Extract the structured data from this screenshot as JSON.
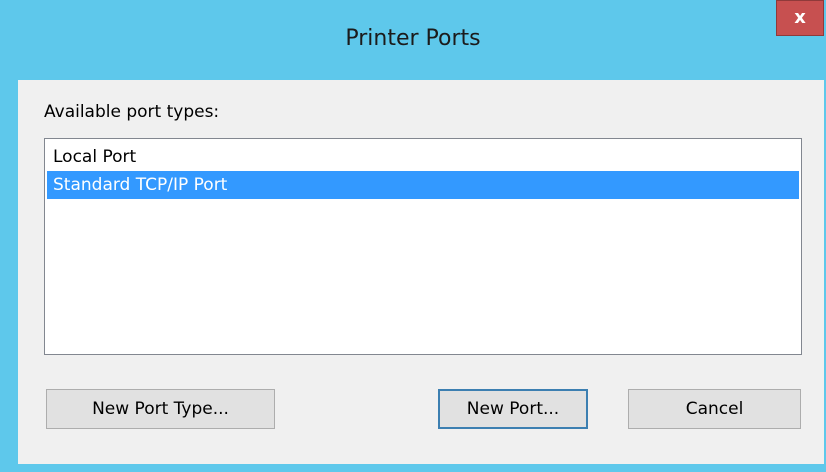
{
  "window": {
    "title": "Printer Ports",
    "close_label": "x"
  },
  "dialog": {
    "label": "Available port types:",
    "items": [
      {
        "label": "Local Port",
        "selected": false
      },
      {
        "label": "Standard TCP/IP Port",
        "selected": true
      }
    ],
    "buttons": {
      "new_port_type": "New Port Type...",
      "new_port": "New Port...",
      "cancel": "Cancel"
    }
  },
  "colors": {
    "titlebar": "#5ec8eb",
    "selection": "#3399ff",
    "close_button": "#c75050"
  }
}
